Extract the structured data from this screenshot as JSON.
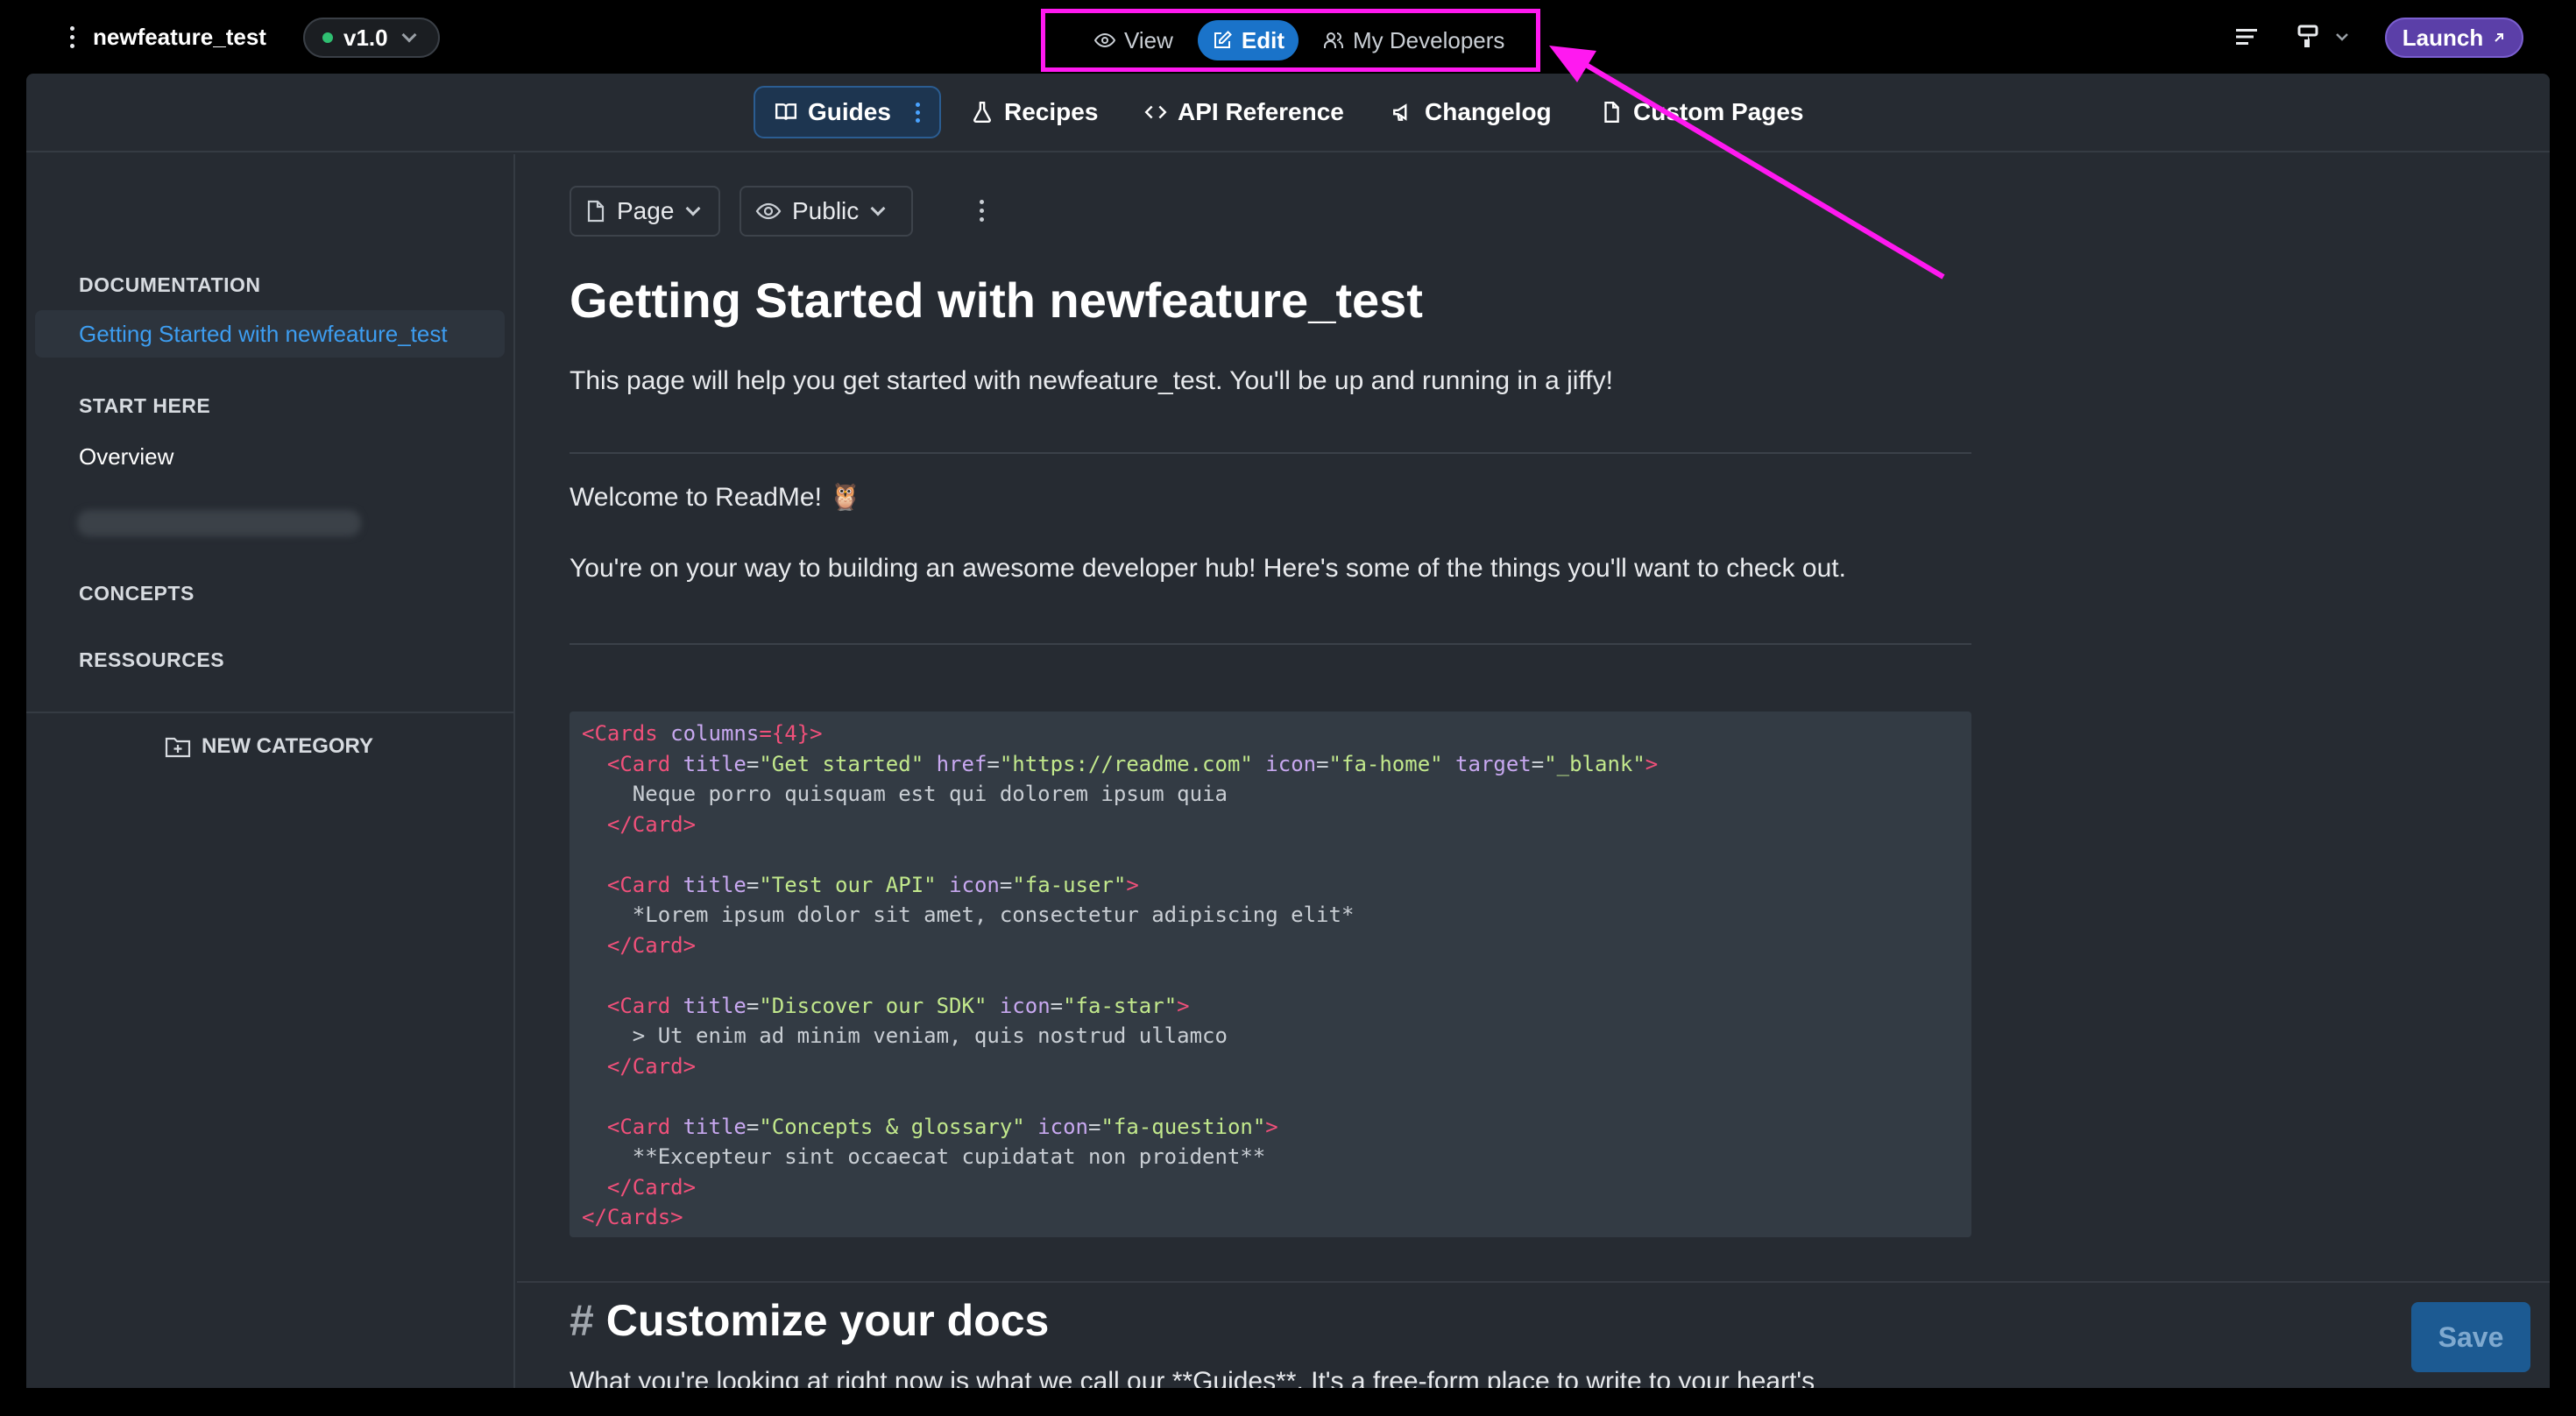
{
  "topbar": {
    "project_name": "newfeature_test",
    "version": "v1.0",
    "modes": [
      {
        "label": "View",
        "icon": "eye-icon",
        "active": false
      },
      {
        "label": "Edit",
        "icon": "edit-icon",
        "active": true
      },
      {
        "label": "My Developers",
        "icon": "users-icon",
        "active": false
      }
    ],
    "launch_label": "Launch"
  },
  "nav": {
    "items": [
      {
        "label": "Guides",
        "icon": "book-icon"
      },
      {
        "label": "Recipes",
        "icon": "flask-icon"
      },
      {
        "label": "API Reference",
        "icon": "code-icon"
      },
      {
        "label": "Changelog",
        "icon": "megaphone-icon"
      },
      {
        "label": "Custom Pages",
        "icon": "file-icon"
      }
    ]
  },
  "sidebar": {
    "sections": [
      {
        "title": "DOCUMENTATION",
        "links": [
          "Getting Started with newfeature_test"
        ]
      },
      {
        "title": "START HERE",
        "links": [
          "Overview"
        ]
      },
      {
        "title": "CONCEPTS",
        "links": []
      },
      {
        "title": "RESSOURCES",
        "links": []
      }
    ],
    "new_category_label": "NEW CATEGORY"
  },
  "editor": {
    "page_type_label": "Page",
    "visibility_label": "Public",
    "title": "Getting Started with newfeature_test",
    "subtitle": "This page will help you get started with newfeature_test. You'll be up and running in a jiffy!",
    "welcome": "Welcome to ReadMe! 🦉",
    "intro": "You're on your way to building an awesome developer hub! Here's some of the things you'll want to check out.",
    "code_lines": [
      [
        [
          "tg",
          "<Cards "
        ],
        [
          "at",
          "columns"
        ],
        [
          "tg",
          "={4}>"
        ]
      ],
      [
        [
          "pl",
          "  "
        ],
        [
          "tg",
          "<Card "
        ],
        [
          "at",
          "title"
        ],
        [
          "pl",
          "="
        ],
        [
          "st",
          "\"Get started\""
        ],
        [
          "pl",
          " "
        ],
        [
          "at",
          "href"
        ],
        [
          "pl",
          "="
        ],
        [
          "st",
          "\"https://readme.com\""
        ],
        [
          "pl",
          " "
        ],
        [
          "at",
          "icon"
        ],
        [
          "pl",
          "="
        ],
        [
          "st",
          "\"fa-home\""
        ],
        [
          "pl",
          " "
        ],
        [
          "at",
          "target"
        ],
        [
          "pl",
          "="
        ],
        [
          "st",
          "\"_blank\""
        ],
        [
          "tg",
          ">"
        ]
      ],
      [
        [
          "pl",
          "    Neque porro quisquam est qui dolorem ipsum quia"
        ]
      ],
      [
        [
          "pl",
          "  "
        ],
        [
          "tg",
          "</Card>"
        ]
      ],
      [
        [
          "pl",
          " "
        ]
      ],
      [
        [
          "pl",
          "  "
        ],
        [
          "tg",
          "<Card "
        ],
        [
          "at",
          "title"
        ],
        [
          "pl",
          "="
        ],
        [
          "st",
          "\"Test our API\""
        ],
        [
          "pl",
          " "
        ],
        [
          "at",
          "icon"
        ],
        [
          "pl",
          "="
        ],
        [
          "st",
          "\"fa-user\""
        ],
        [
          "tg",
          ">"
        ]
      ],
      [
        [
          "pl",
          "    *Lorem ipsum dolor sit amet, consectetur adipiscing elit*"
        ]
      ],
      [
        [
          "pl",
          "  "
        ],
        [
          "tg",
          "</Card>"
        ]
      ],
      [
        [
          "pl",
          " "
        ]
      ],
      [
        [
          "pl",
          "  "
        ],
        [
          "tg",
          "<Card "
        ],
        [
          "at",
          "title"
        ],
        [
          "pl",
          "="
        ],
        [
          "st",
          "\"Discover our SDK\""
        ],
        [
          "pl",
          " "
        ],
        [
          "at",
          "icon"
        ],
        [
          "pl",
          "="
        ],
        [
          "st",
          "\"fa-star\""
        ],
        [
          "tg",
          ">"
        ]
      ],
      [
        [
          "pl",
          "    > Ut enim ad minim veniam, quis nostrud ullamco"
        ]
      ],
      [
        [
          "pl",
          "  "
        ],
        [
          "tg",
          "</Card>"
        ]
      ],
      [
        [
          "pl",
          " "
        ]
      ],
      [
        [
          "pl",
          "  "
        ],
        [
          "tg",
          "<Card "
        ],
        [
          "at",
          "title"
        ],
        [
          "pl",
          "="
        ],
        [
          "st",
          "\"Concepts & glossary\""
        ],
        [
          "pl",
          " "
        ],
        [
          "at",
          "icon"
        ],
        [
          "pl",
          "="
        ],
        [
          "st",
          "\"fa-question\""
        ],
        [
          "tg",
          ">"
        ]
      ],
      [
        [
          "pl",
          "    **Excepteur sint occaecat cupidatat non proident**"
        ]
      ],
      [
        [
          "pl",
          "  "
        ],
        [
          "tg",
          "</Card>"
        ]
      ],
      [
        [
          "tg",
          "</Cards>"
        ]
      ]
    ],
    "heading_hash": "#",
    "heading_text": "Customize your docs",
    "cut_paragraph": "What you're looking at right now is what we call our **Guides**. It's a free-form place to write to your heart's"
  },
  "save_label": "Save",
  "colors": {
    "accent": "#1a73c9",
    "annotation": "#ff19f0",
    "launch": "#5b3fa8",
    "active_link": "#3d9df0"
  }
}
